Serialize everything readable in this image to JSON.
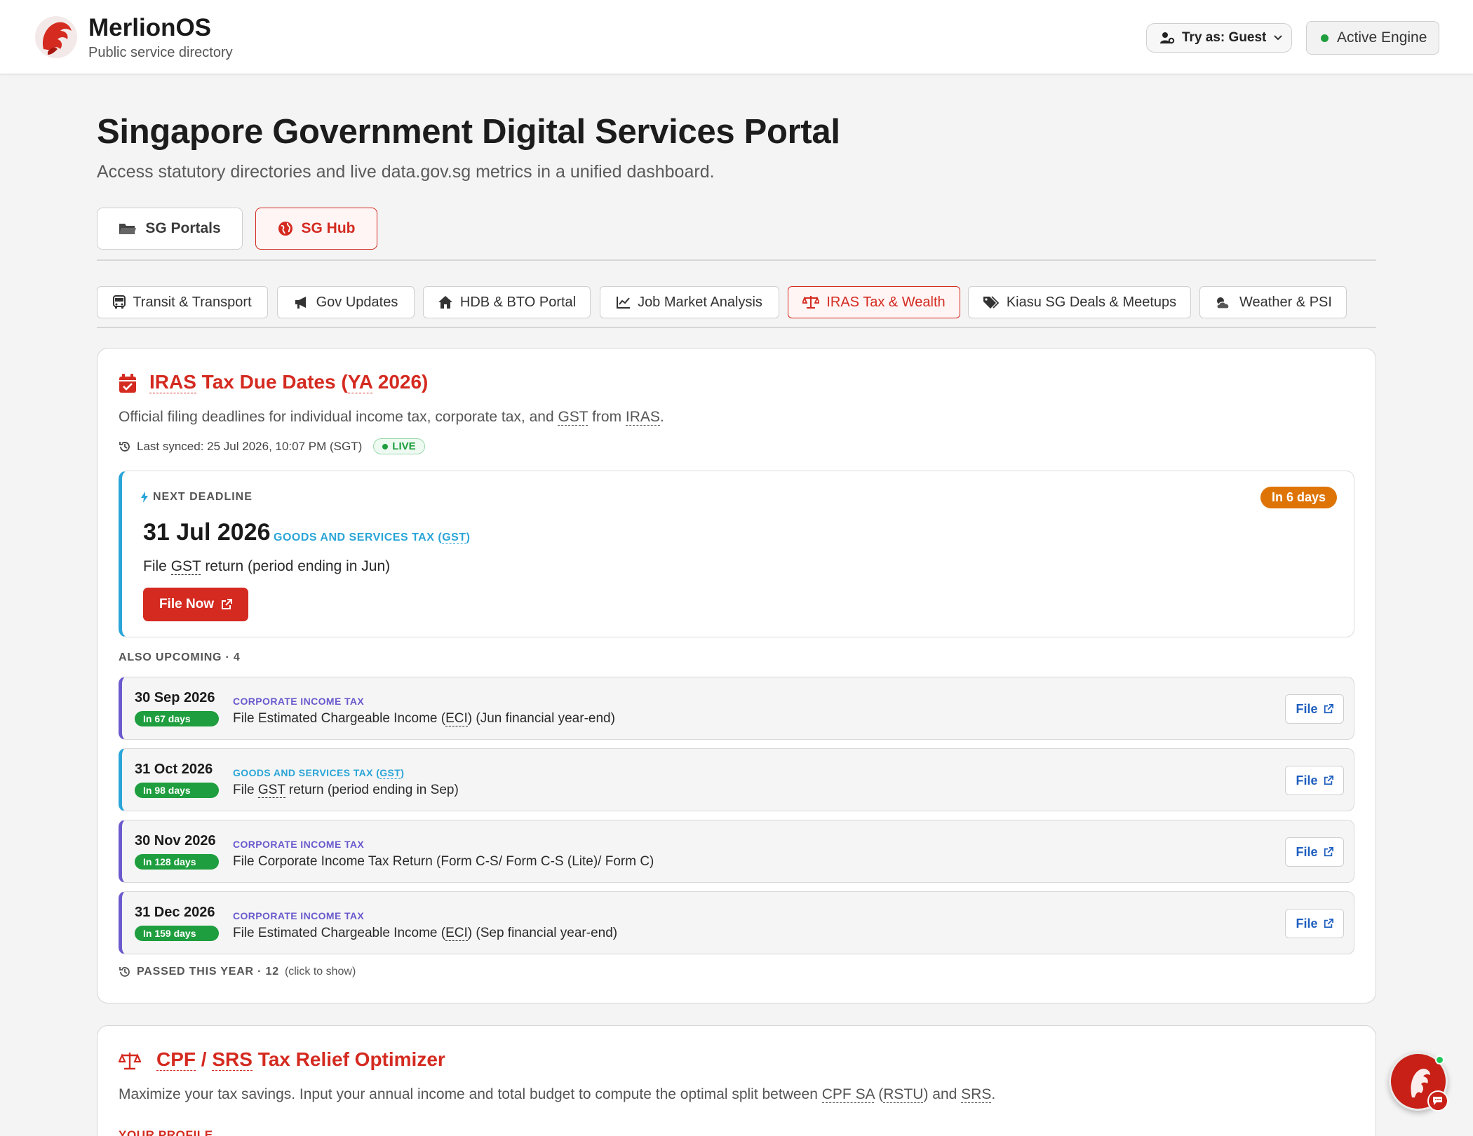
{
  "header": {
    "brand_name": "MerlionOS",
    "brand_sub": "Public service directory",
    "try_as_label": "Try as: Guest",
    "engine_label": "Active Engine"
  },
  "page": {
    "title": "Singapore Government Digital Services Portal",
    "subtitle": "Access statutory directories and live data.gov.sg metrics in a unified dashboard."
  },
  "main_tabs": [
    {
      "label": "SG Portals",
      "icon": "folder-icon"
    },
    {
      "label": "SG Hub",
      "icon": "globe-icon",
      "active": true
    }
  ],
  "sub_tabs": [
    {
      "label": "Transit & Transport",
      "icon": "bus-icon"
    },
    {
      "label": "Gov Updates",
      "icon": "megaphone-icon"
    },
    {
      "label": "HDB & BTO Portal",
      "icon": "home-icon"
    },
    {
      "label": "Job Market Analysis",
      "icon": "line-chart-icon"
    },
    {
      "label": "IRAS Tax & Wealth",
      "icon": "scale-icon",
      "active": true
    },
    {
      "label": "Kiasu SG Deals & Meetups",
      "icon": "tags-icon"
    },
    {
      "label": "Weather & PSI",
      "icon": "cloud-sun-icon"
    }
  ],
  "tax_card": {
    "title_prefix": "IRAS",
    "title_rest": " Tax Due Dates (",
    "title_ya": "YA",
    "title_year": " 2026)",
    "desc_prefix": "Official filing deadlines for individual income tax, corporate tax, and ",
    "desc_gst": "GST",
    "desc_mid": " from ",
    "desc_iras": "IRAS",
    "desc_end": ".",
    "synced": "Last synced: 25 Jul 2026, 10:07 PM (SGT)",
    "live": "LIVE",
    "next": {
      "label": "NEXT DEADLINE",
      "date": "31 Jul 2026",
      "category_prefix": "GOODS AND SERVICES TAX (",
      "category_abbr": "GST",
      "category_suffix": ")",
      "text_prefix": "File ",
      "text_abbr": "GST",
      "text_suffix": " return (period ending in Jun)",
      "button": "File Now",
      "days": "In 6 days"
    },
    "also_label": "ALSO UPCOMING · 4",
    "upcoming": [
      {
        "date": "30 Sep 2026",
        "days": "In 67 days",
        "category": "CORPORATE INCOME TAX",
        "text_prefix": "File Estimated Chargeable Income (",
        "text_abbr": "ECI",
        "text_suffix": ") (Jun financial year-end)",
        "button": "File"
      },
      {
        "date": "31 Oct 2026",
        "days": "In 98 days",
        "category_prefix": "GOODS AND SERVICES TAX (",
        "category_abbr": "GST",
        "category_suffix": ")",
        "text_prefix": "File ",
        "text_abbr": "GST",
        "text_suffix": " return (period ending in Sep)",
        "button": "File"
      },
      {
        "date": "30 Nov 2026",
        "days": "In 128 days",
        "category": "CORPORATE INCOME TAX",
        "text": "File Corporate Income Tax Return (Form C-S/ Form C-S (Lite)/ Form C)",
        "button": "File"
      },
      {
        "date": "31 Dec 2026",
        "days": "In 159 days",
        "category": "CORPORATE INCOME TAX",
        "text_prefix": "File Estimated Chargeable Income (",
        "text_abbr": "ECI",
        "text_suffix": ") (Sep financial year-end)",
        "button": "File"
      }
    ],
    "passed_label": "PASSED THIS YEAR · 12",
    "passed_hint": "(click to show)"
  },
  "cpf_card": {
    "title_cpf": "CPF",
    "title_sep": " / ",
    "title_srs": "SRS",
    "title_rest": " Tax Relief Optimizer",
    "desc_prefix": "Maximize your tax savings. Input your annual income and total budget to compute the optimal split between ",
    "desc_cpf": "CPF SA",
    "desc_space": " (",
    "desc_rstu": "RSTU",
    "desc_and": ") and ",
    "desc_srs": "SRS",
    "desc_end": ".",
    "profile_label": "YOUR PROFILE"
  },
  "colors": {
    "brand_red": "#d42a20",
    "gst_blue": "#2aa5d8",
    "cit_purple": "#6a5acd",
    "days_green": "#1e9e3e",
    "urgent_orange": "#de7406"
  }
}
